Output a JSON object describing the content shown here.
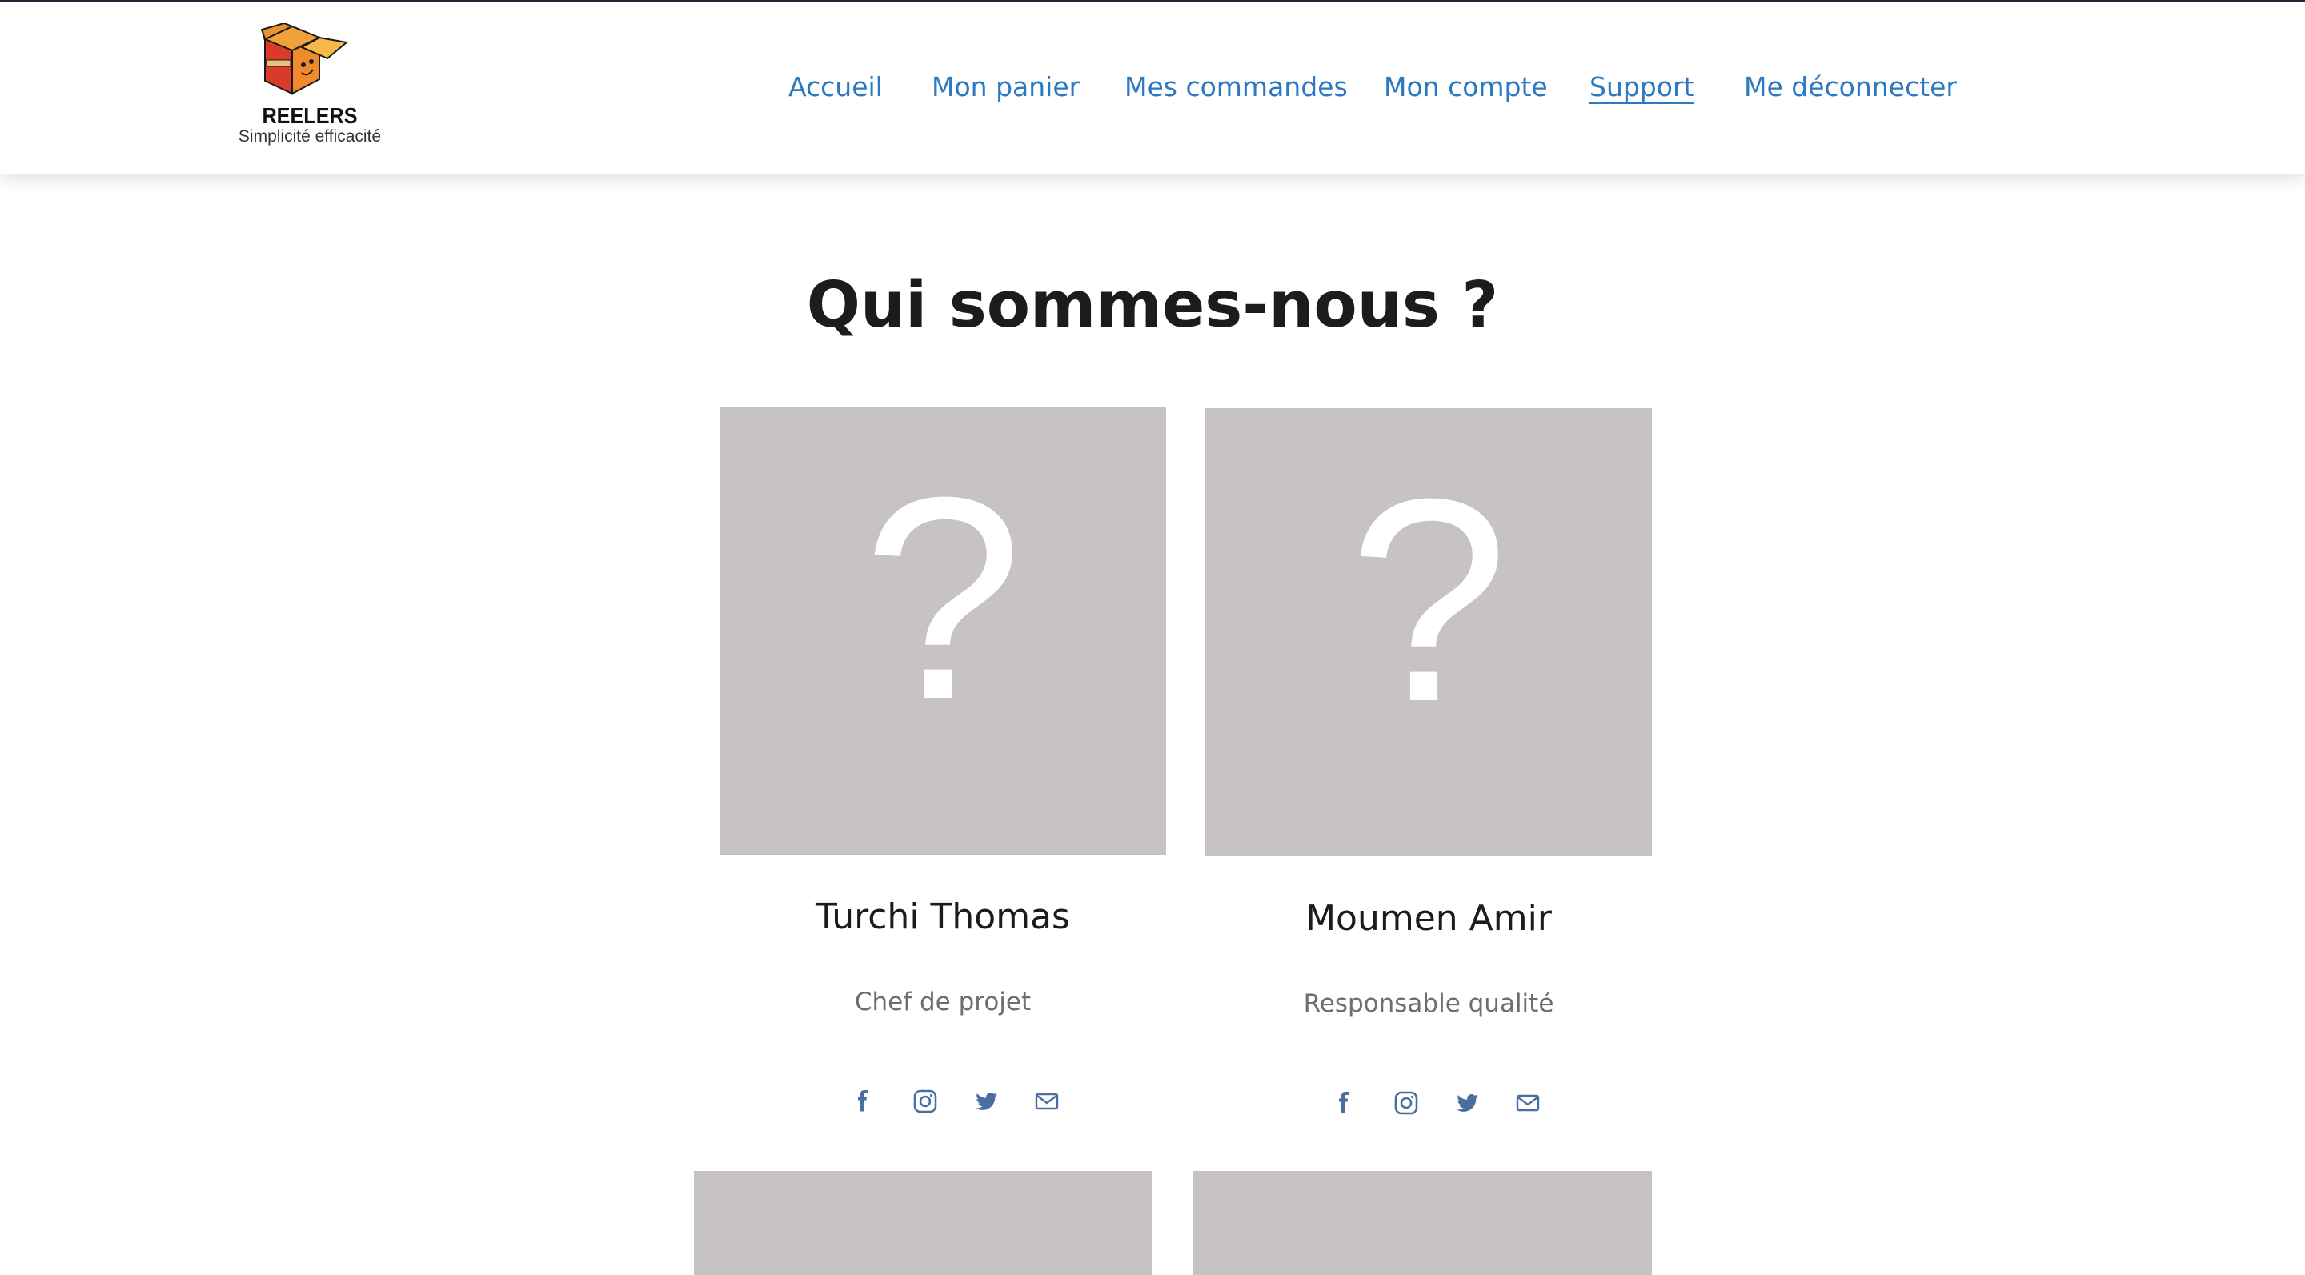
{
  "header": {
    "brand": "REELERS",
    "tagline": "Simplicité efficacité",
    "logo_box_label": "REELERS",
    "nav": [
      {
        "label": "Accueil",
        "active": false
      },
      {
        "label": "Mon panier",
        "active": false
      },
      {
        "label": "Mes commandes",
        "active": false
      },
      {
        "label": "Mon compte",
        "active": false
      },
      {
        "label": "Support",
        "active": true
      },
      {
        "label": "Me déconnecter",
        "active": false
      }
    ]
  },
  "main": {
    "title": "Qui sommes-nous ?",
    "members": [
      {
        "photo_placeholder": "?",
        "name": "Turchi Thomas",
        "role": "Chef de projet",
        "socials": [
          "facebook-icon",
          "instagram-icon",
          "twitter-icon",
          "mail-icon"
        ]
      },
      {
        "photo_placeholder": "?",
        "name": "Moumen Amir",
        "role": "Responsable qualité",
        "socials": [
          "facebook-icon",
          "instagram-icon",
          "twitter-icon",
          "mail-icon"
        ]
      }
    ]
  },
  "colors": {
    "nav_link": "#2b79c2",
    "social_icon": "#4a6ea0",
    "photo_placeholder_bg": "#c8c3c3",
    "top_line": "#1d2b3a"
  }
}
